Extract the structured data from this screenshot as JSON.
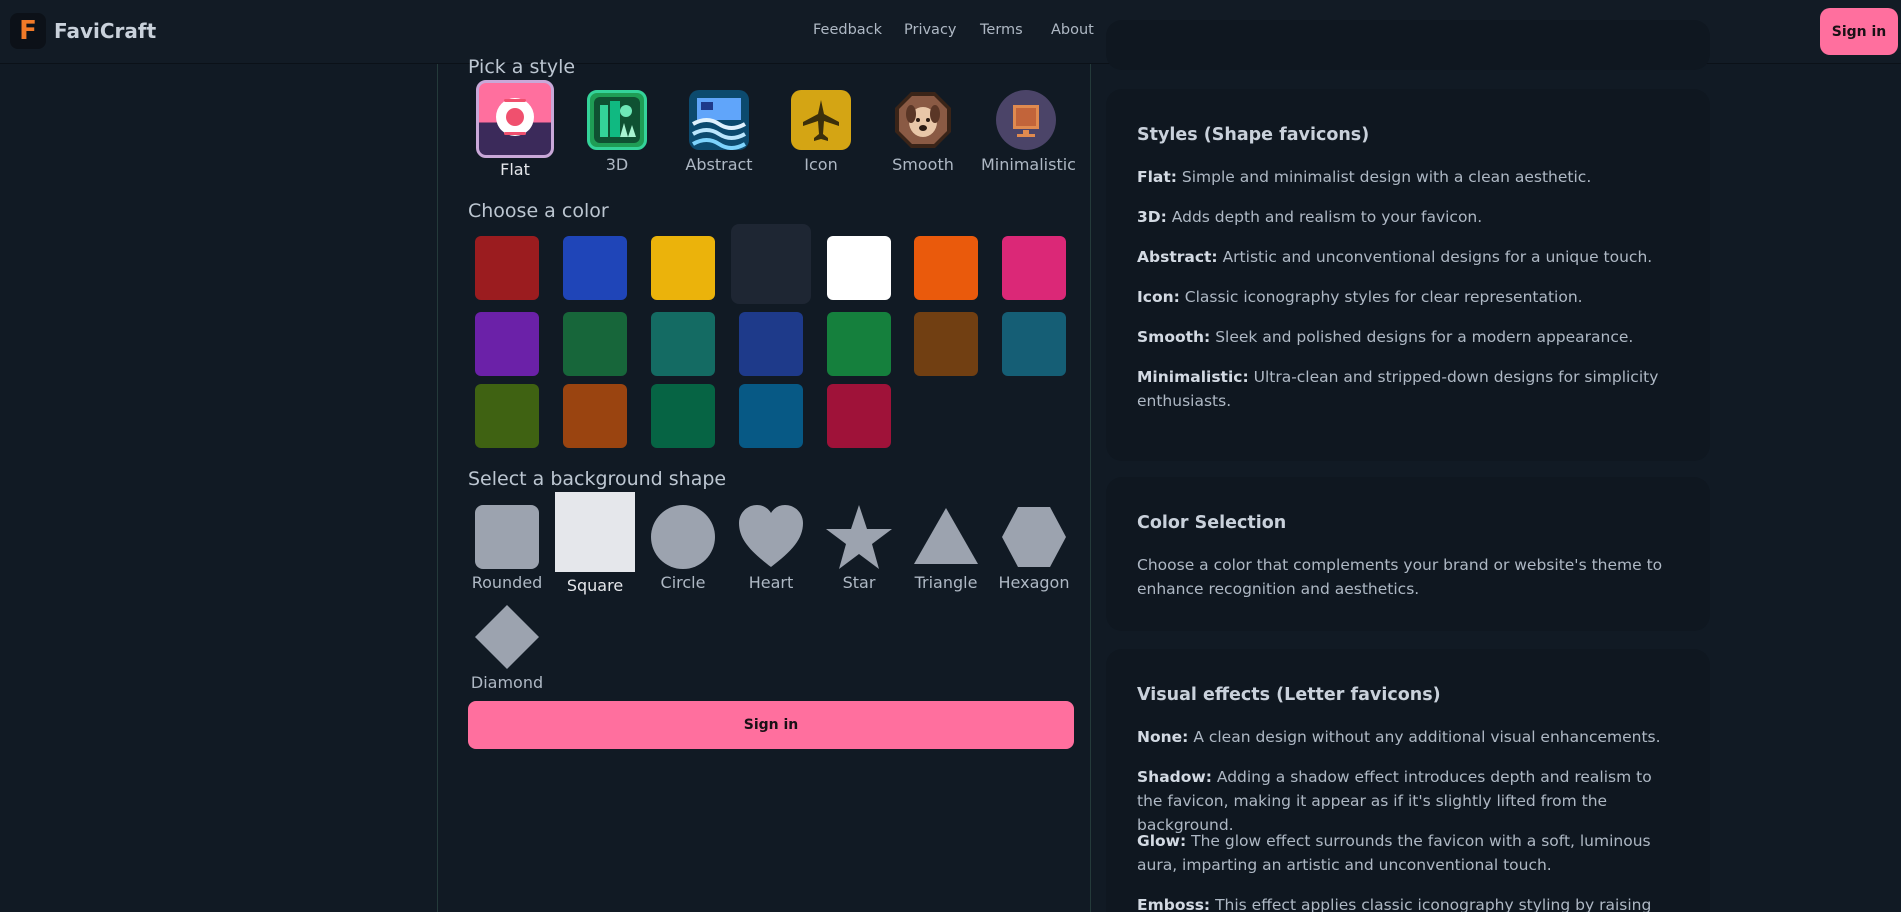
{
  "header": {
    "brand": "FaviCraft",
    "logo_letter": "F",
    "nav": [
      "Feedback",
      "Privacy",
      "Terms",
      "About"
    ],
    "signin": "Sign in"
  },
  "left": {
    "style_title": "Pick a style",
    "styles": [
      "Flat",
      "3D",
      "Abstract",
      "Icon",
      "Smooth",
      "Minimalistic"
    ],
    "selected_style": "Flat",
    "color_title": "Choose a color",
    "colors": [
      "#9b1c1f",
      "#1f45b8",
      "#ebb30b",
      "#1e2633",
      "#ffffff",
      "#ea5a0c",
      "#db2877",
      "#6b21a8",
      "#17663a",
      "#146b63",
      "#1e3a8a",
      "#15803d",
      "#713f12",
      "#155e75",
      "#3f6212",
      "#9a4410",
      "#066444",
      "#075985",
      "#9f1239"
    ],
    "selected_color": "#1e2633",
    "shape_title": "Select a background shape",
    "shapes": [
      "Rounded",
      "Square",
      "Circle",
      "Heart",
      "Star",
      "Triangle",
      "Hexagon",
      "Diamond"
    ],
    "selected_shape": "Square",
    "signin_button": "Sign in"
  },
  "right": {
    "styles_card": {
      "title": "Styles (Shape favicons)",
      "items": [
        {
          "term": "Flat:",
          "desc": "Simple and minimalist design with a clean aesthetic."
        },
        {
          "term": "3D:",
          "desc": "Adds depth and realism to your favicon."
        },
        {
          "term": "Abstract:",
          "desc": "Artistic and unconventional designs for a unique touch."
        },
        {
          "term": "Icon:",
          "desc": "Classic iconography styles for clear representation."
        },
        {
          "term": "Smooth:",
          "desc": "Sleek and polished designs for a modern appearance."
        },
        {
          "term": "Minimalistic:",
          "desc": "Ultra-clean and stripped-down designs for simplicity enthusiasts."
        }
      ]
    },
    "color_card": {
      "title": "Color Selection",
      "text": "Choose a color that complements your brand or website's theme to enhance recognition and aesthetics."
    },
    "effects_card": {
      "title": "Visual effects (Letter favicons)",
      "items": [
        {
          "term": "None:",
          "desc": "A clean design without any additional visual enhancements."
        },
        {
          "term": "Shadow:",
          "desc": "Adding a shadow effect introduces depth and realism to the favicon, making it appear as if it's slightly lifted from the background."
        },
        {
          "term": "Glow:",
          "desc": "The glow effect surrounds the favicon with a soft, luminous aura, imparting an artistic and unconventional touch."
        },
        {
          "term": "Emboss:",
          "desc": "This effect applies classic iconography styling by raising the icon's"
        }
      ]
    }
  },
  "colors": {
    "accent": "#ff6f9e",
    "background": "#111a24",
    "card": "#0f1720",
    "shape_fill": "#9ca3af",
    "shape_selected": "#e5e7eb"
  }
}
